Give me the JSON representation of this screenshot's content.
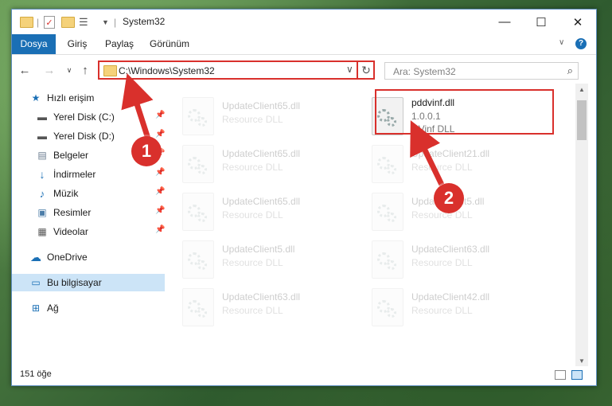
{
  "window": {
    "title": "System32"
  },
  "ribbon": {
    "tabs": [
      "Dosya",
      "Giriş",
      "Paylaş",
      "Görünüm"
    ]
  },
  "address": {
    "path": "C:\\Windows\\System32"
  },
  "search": {
    "placeholder": "Ara: System32"
  },
  "nav": {
    "quick_access": "Hızlı erişim",
    "items": [
      {
        "label": "Yerel Disk (C:)",
        "icon": "drive-icon",
        "pinned": true
      },
      {
        "label": "Yerel Disk (D:)",
        "icon": "drive-icon",
        "pinned": true
      },
      {
        "label": "Belgeler",
        "icon": "documents-icon",
        "pinned": true
      },
      {
        "label": "İndirmeler",
        "icon": "download-icon",
        "pinned": true
      },
      {
        "label": "Müzik",
        "icon": "music-icon",
        "pinned": true
      },
      {
        "label": "Resimler",
        "icon": "pictures-icon",
        "pinned": true
      },
      {
        "label": "Videolar",
        "icon": "videos-icon",
        "pinned": true
      }
    ],
    "onedrive": "OneDrive",
    "this_pc": "Bu bilgisayar",
    "network": "Ağ"
  },
  "files": {
    "highlighted": {
      "name": "pddvinf.dll",
      "version": "1.0.0.1",
      "description": "DVinf DLL"
    },
    "left_column": [
      {
        "name": "UpdateClient65.dll",
        "description": "Resource DLL"
      },
      {
        "name": "UpdateClient65.dll",
        "description": "Resource DLL"
      },
      {
        "name": "UpdateClient65.dll",
        "description": "Resource DLL"
      },
      {
        "name": "UpdateClient5.dll",
        "description": "Resource DLL"
      },
      {
        "name": "UpdateClient63.dll",
        "description": "Resource DLL"
      }
    ],
    "right_column": [
      {
        "name": "UpdateClient21.dll",
        "description": "Resource DLL"
      },
      {
        "name": "UpdateClient5.dll",
        "description": "Resource DLL"
      },
      {
        "name": "UpdateClient63.dll",
        "description": "Resource DLL"
      },
      {
        "name": "UpdateClient42.dll",
        "description": "Resource DLL"
      }
    ]
  },
  "status": {
    "count": "151 öğe"
  },
  "annotations": {
    "step1": "1",
    "step2": "2"
  },
  "colors": {
    "accent": "#1a6fb5",
    "highlight": "#d9302c"
  }
}
